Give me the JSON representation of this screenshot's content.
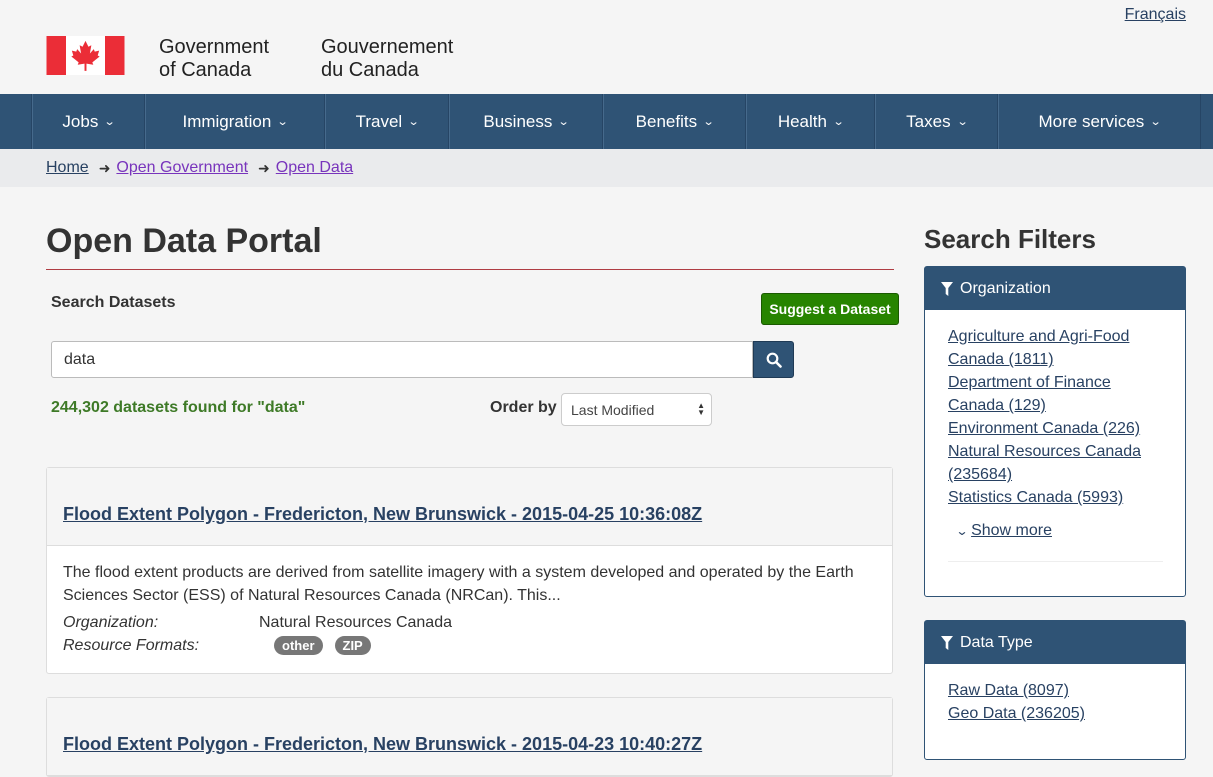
{
  "header": {
    "lang_link": "Français",
    "brand_en": [
      "Government",
      "of Canada"
    ],
    "brand_fr": [
      "Gouvernement",
      "du Canada"
    ],
    "flag_color": "#eb2d37"
  },
  "nav": {
    "items": [
      {
        "label": "Jobs"
      },
      {
        "label": "Immigration"
      },
      {
        "label": "Travel"
      },
      {
        "label": "Business"
      },
      {
        "label": "Benefits"
      },
      {
        "label": "Health"
      },
      {
        "label": "Taxes"
      },
      {
        "label": "More services"
      }
    ]
  },
  "breadcrumb": {
    "items": [
      "Home",
      "Open Government",
      "Open Data"
    ]
  },
  "main": {
    "title": "Open Data Portal",
    "search_label": "Search Datasets",
    "suggest_button": "Suggest a Dataset",
    "search_value": "data",
    "result_count": "244,302 datasets found for \"data\"",
    "order_label": "Order by",
    "order_value": "Last Modified"
  },
  "results": [
    {
      "title": "Flood Extent Polygon - Fredericton, New Brunswick - 2015-04-25 10:36:08Z",
      "description": "The flood extent products are derived from satellite imagery with a system developed and operated by the Earth Sciences Sector (ESS) of Natural Resources Canada (NRCan). This...",
      "org_label": "Organization:",
      "org_value": "Natural Resources Canada",
      "formats_label": "Resource Formats:",
      "formats": [
        "other",
        "ZIP"
      ]
    },
    {
      "title": "Flood Extent Polygon - Fredericton, New Brunswick - 2015-04-23 10:40:27Z"
    }
  ],
  "sidebar": {
    "title": "Search Filters",
    "organization": {
      "heading": "Organization",
      "items": [
        "Agriculture and Agri-Food Canada (1811)",
        "Department of Finance Canada (129)",
        "Environment Canada (226)",
        "Natural Resources Canada (235684)",
        "Statistics Canada (5993)"
      ],
      "show_more": "Show more"
    },
    "data_type": {
      "heading": "Data Type",
      "items": [
        "Raw Data (8097)",
        "Geo Data (236205)"
      ]
    }
  }
}
